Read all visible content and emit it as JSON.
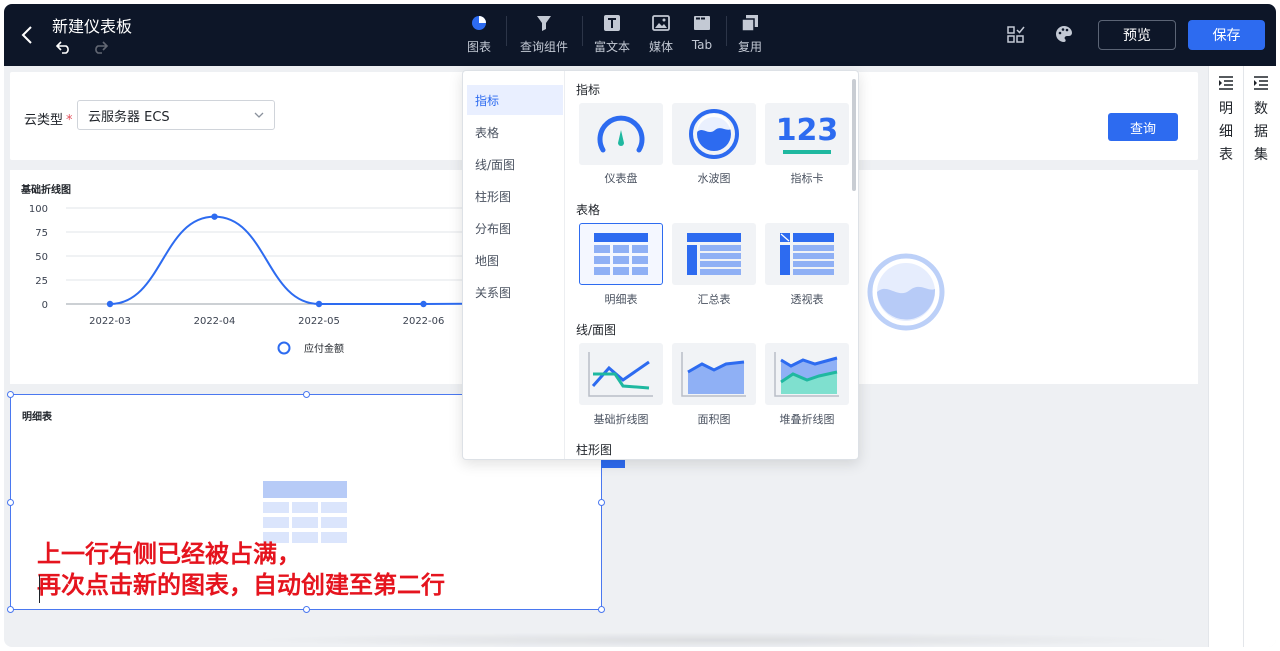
{
  "header": {
    "title": "新建仪表板",
    "tools": [
      {
        "label": "图表",
        "icon": "pie-chart-icon"
      },
      {
        "label": "查询组件",
        "icon": "filter-icon"
      },
      {
        "label": "富文本",
        "icon": "text-icon"
      },
      {
        "label": "媒体",
        "icon": "image-icon"
      },
      {
        "label": "Tab",
        "icon": "tab-icon"
      },
      {
        "label": "复用",
        "icon": "copy-icon"
      }
    ],
    "preview_label": "预览",
    "save_label": "保存"
  },
  "right_panel": {
    "detail_table_chars": [
      "明",
      "细",
      "表"
    ],
    "dataset_chars": [
      "数",
      "据",
      "集"
    ]
  },
  "filter": {
    "label": "云类型",
    "required_mark": "*",
    "select_value": "云服务器 ECS",
    "query_label": "查询"
  },
  "line_card": {
    "title": "基础折线图"
  },
  "chart_data": {
    "type": "line",
    "categories": [
      "2022-03",
      "2022-04",
      "2022-05",
      "2022-06"
    ],
    "series": [
      {
        "name": "应付金额",
        "values": [
          0,
          91,
          0,
          0
        ]
      }
    ],
    "ylim": [
      0,
      100
    ],
    "yticks": [
      0,
      25,
      50,
      75,
      100
    ],
    "legend_position": "bottom",
    "colors": [
      "#2d6bf0"
    ]
  },
  "table_card": {
    "title": "明细表",
    "note_line1": "上一行右侧已经被占满，",
    "note_line2": "再次点击新的图表，自动创建至第二行"
  },
  "popup": {
    "nav": [
      "指标",
      "表格",
      "线/面图",
      "柱形图",
      "分布图",
      "地图",
      "关系图"
    ],
    "sections": {
      "metric": {
        "title": "指标",
        "items": [
          "仪表盘",
          "水波图",
          "指标卡"
        ],
        "metric_card_number": "123"
      },
      "table": {
        "title": "表格",
        "items": [
          "明细表",
          "汇总表",
          "透视表"
        ]
      },
      "line": {
        "title": "线/面图",
        "items": [
          "基础折线图",
          "面积图",
          "堆叠折线图"
        ]
      },
      "bar": {
        "title": "柱形图"
      }
    }
  },
  "colors": {
    "accent": "#2d6bf0",
    "topbar": "#0d1628",
    "note_red": "#e5141e"
  }
}
